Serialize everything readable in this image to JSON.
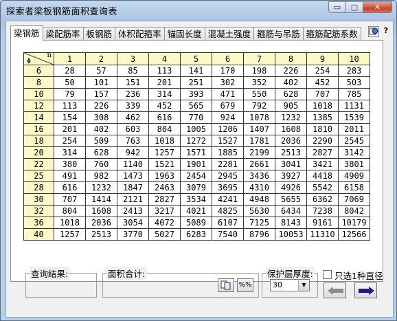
{
  "window": {
    "title": "探索者梁板钢筋面积查询表",
    "min_symbol": "▭",
    "max_symbol": "□",
    "close_symbol": "✕"
  },
  "tabs": [
    "梁钢筋",
    "梁配筋率",
    "板钢筋",
    "体积配箍率",
    "锚固长度",
    "混凝土强度",
    "箍筋与吊筋",
    "箍筋配筋系数"
  ],
  "tab_icons": [
    "globe-icon",
    "help-icon"
  ],
  "help_symbol": "?",
  "table": {
    "corner_n": "n",
    "corner_phi": "Φ",
    "columns": [
      "1",
      "2",
      "3",
      "4",
      "5",
      "6",
      "7",
      "8",
      "9",
      "10"
    ],
    "rows": [
      {
        "d": "6",
        "v": [
          "28",
          "57",
          "85",
          "113",
          "141",
          "170",
          "198",
          "226",
          "254",
          "283"
        ]
      },
      {
        "d": "8",
        "v": [
          "50",
          "101",
          "151",
          "201",
          "251",
          "302",
          "352",
          "402",
          "452",
          "503"
        ]
      },
      {
        "d": "10",
        "v": [
          "79",
          "157",
          "236",
          "314",
          "393",
          "471",
          "550",
          "628",
          "707",
          "785"
        ]
      },
      {
        "d": "12",
        "v": [
          "113",
          "226",
          "339",
          "452",
          "565",
          "679",
          "792",
          "905",
          "1018",
          "1131"
        ]
      },
      {
        "d": "14",
        "v": [
          "154",
          "308",
          "462",
          "616",
          "770",
          "924",
          "1078",
          "1232",
          "1385",
          "1539"
        ]
      },
      {
        "d": "16",
        "v": [
          "201",
          "402",
          "603",
          "804",
          "1005",
          "1206",
          "1407",
          "1608",
          "1810",
          "2011"
        ]
      },
      {
        "d": "18",
        "v": [
          "254",
          "509",
          "763",
          "1018",
          "1272",
          "1527",
          "1781",
          "2036",
          "2290",
          "2545"
        ]
      },
      {
        "d": "20",
        "v": [
          "314",
          "628",
          "942",
          "1257",
          "1571",
          "1885",
          "2199",
          "2513",
          "2827",
          "3142"
        ]
      },
      {
        "d": "22",
        "v": [
          "380",
          "760",
          "1140",
          "1521",
          "1901",
          "2281",
          "2661",
          "3041",
          "3421",
          "3801"
        ]
      },
      {
        "d": "25",
        "v": [
          "491",
          "982",
          "1473",
          "1963",
          "2454",
          "2945",
          "3436",
          "3927",
          "4418",
          "4909"
        ]
      },
      {
        "d": "28",
        "v": [
          "616",
          "1232",
          "1847",
          "2463",
          "3079",
          "3695",
          "4310",
          "4926",
          "5542",
          "6158"
        ]
      },
      {
        "d": "30",
        "v": [
          "707",
          "1414",
          "2121",
          "2827",
          "3534",
          "4241",
          "4948",
          "5655",
          "6362",
          "7069"
        ]
      },
      {
        "d": "32",
        "v": [
          "804",
          "1608",
          "2413",
          "3217",
          "4021",
          "4825",
          "5630",
          "6434",
          "7238",
          "8042"
        ]
      },
      {
        "d": "36",
        "v": [
          "1018",
          "2036",
          "3054",
          "4072",
          "5089",
          "6107",
          "7125",
          "8143",
          "9161",
          "10179"
        ]
      },
      {
        "d": "40",
        "v": [
          "1257",
          "2513",
          "3770",
          "5027",
          "6283",
          "7540",
          "8796",
          "10053",
          "11310",
          "12566"
        ]
      }
    ]
  },
  "bottom": {
    "result_label": "查询结果:",
    "area_label": "面积合计:",
    "copy_button_icon": "copy-icon",
    "percent_button": "%%",
    "cover_label": "保护层厚度:",
    "cover_value": "30",
    "cover_arrow": "▼",
    "single_diameter_label": "只选1种直径",
    "single_diameter_checked": false,
    "back_arrow_color": "#8c8c8c",
    "forward_arrow_color": "#1a1a8c"
  }
}
